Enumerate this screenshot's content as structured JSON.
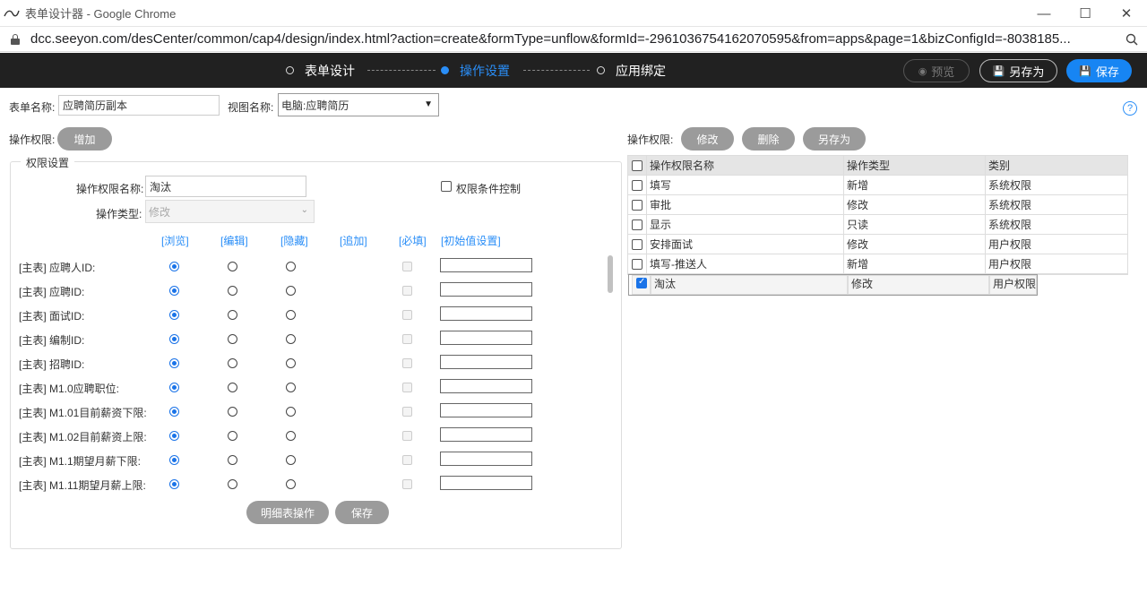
{
  "window": {
    "title": "表单设计器 - Google Chrome",
    "favicon_text": "Seeyon"
  },
  "address": {
    "url": "dcc.seeyon.com/desCenter/common/cap4/design/index.html?action=create&formType=unflow&formId=-2961036754162070595&from=apps&page=1&bizConfigId=-8038185..."
  },
  "steps": [
    {
      "label": "表单设计",
      "active": false
    },
    {
      "label": "操作设置",
      "active": true
    },
    {
      "label": "应用绑定",
      "active": false
    }
  ],
  "header_buttons": {
    "preview": "预览",
    "saveas": "另存为",
    "save": "保存"
  },
  "form": {
    "form_name_label": "表单名称:",
    "form_name_value": "应聘简历副本",
    "view_name_label": "视图名称:",
    "view_name_value": "电脑:应聘简历",
    "op_perm_label": "操作权限:",
    "add_button": "增加"
  },
  "perm_settings": {
    "legend": "权限设置",
    "name_label": "操作权限名称:",
    "name_value": "淘汰",
    "condition_label": "权限条件控制",
    "type_label": "操作类型:",
    "type_value": "修改",
    "columns": [
      "[浏览]",
      "[编辑]",
      "[隐藏]",
      "[追加]",
      "[必填]",
      "[初始值设置]"
    ],
    "rows": [
      "[主表] 应聘人ID:",
      "[主表] 应聘ID:",
      "[主表] 面试ID:",
      "[主表] 编制ID:",
      "[主表] 招聘ID:",
      "[主表] M1.0应聘职位:",
      "[主表] M1.01目前薪资下限:",
      "[主表] M1.02目前薪资上限:",
      "[主表] M1.1期望月薪下限:",
      "[主表] M1.11期望月薪上限:"
    ],
    "detail_button": "明细表操作",
    "save_button": "保存"
  },
  "right_panel": {
    "label": "操作权限:",
    "buttons": {
      "modify": "修改",
      "delete": "删除",
      "saveas": "另存为"
    },
    "table_headers": [
      "操作权限名称",
      "操作类型",
      "类别"
    ],
    "table_rows": [
      {
        "name": "填写",
        "type": "新增",
        "category": "系统权限",
        "checked": false
      },
      {
        "name": "审批",
        "type": "修改",
        "category": "系统权限",
        "checked": false
      },
      {
        "name": "显示",
        "type": "只读",
        "category": "系统权限",
        "checked": false
      },
      {
        "name": "安排面试",
        "type": "修改",
        "category": "用户权限",
        "checked": false
      },
      {
        "name": "填写-推送人",
        "type": "新增",
        "category": "用户权限",
        "checked": false
      },
      {
        "name": "淘汰",
        "type": "修改",
        "category": "用户权限",
        "checked": true
      }
    ]
  },
  "colors": {
    "accent": "#2a8ef7",
    "header_bg": "#212121",
    "save_btn": "#1785f3",
    "gray_btn": "#9b9b9b"
  }
}
